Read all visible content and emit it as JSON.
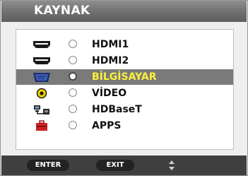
{
  "title": "KAYNAK",
  "items": [
    {
      "icon": "hdmi-icon",
      "label": "HDMI1",
      "selected": false
    },
    {
      "icon": "hdmi-icon",
      "label": "HDMI2",
      "selected": false
    },
    {
      "icon": "computer-vga-icon",
      "label": "BİLGİSAYAR",
      "selected": true
    },
    {
      "icon": "video-rca-icon",
      "label": "VİDEO",
      "selected": false
    },
    {
      "icon": "hdbaset-network-icon",
      "label": "HDBaseT",
      "selected": false
    },
    {
      "icon": "apps-briefcase-icon",
      "label": "APPS",
      "selected": false
    }
  ],
  "footer": {
    "enter_label": "ENTER",
    "exit_label": "EXIT",
    "updown_icon": "up-down-arrows-icon"
  },
  "colors": {
    "selected_row": "#7a7a7a",
    "selected_text": "#ffef3a",
    "title_bar": "#7a7a7a",
    "footer": "#3f3f3f",
    "video_connector": "#f2d400",
    "apps_icon": "#cc2020"
  }
}
